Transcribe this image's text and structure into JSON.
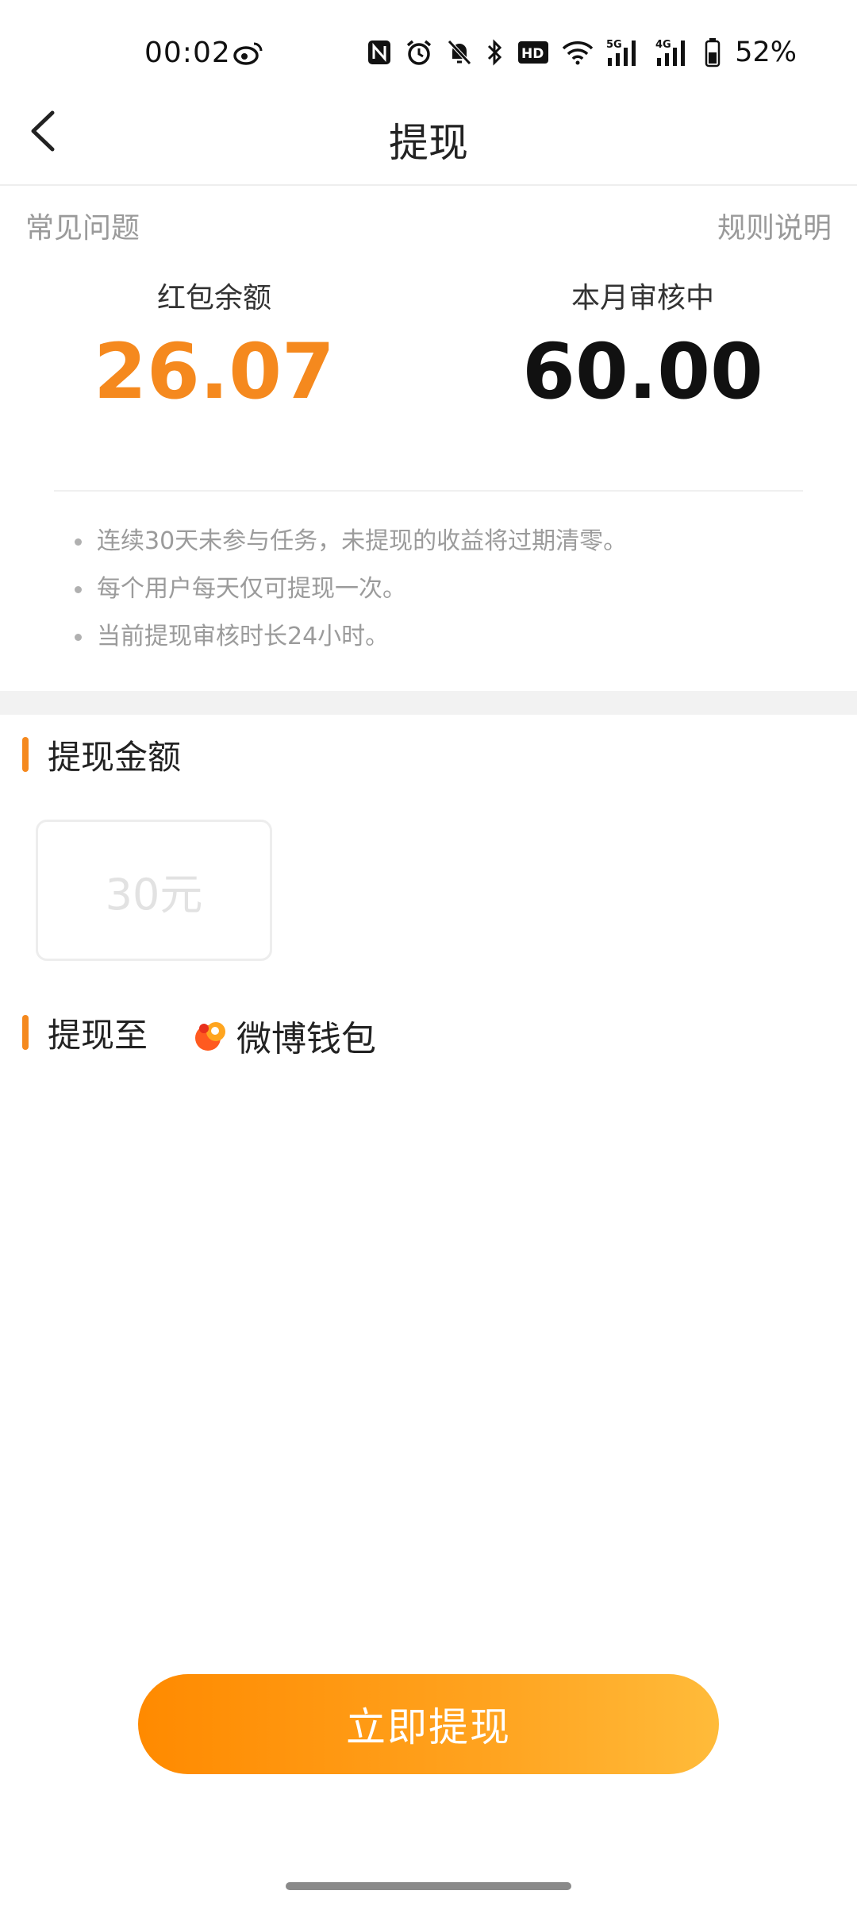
{
  "status_bar": {
    "time": "00:02",
    "battery": "52%",
    "network_5g": "5G",
    "network_4g": "4G",
    "hd_label": "HD",
    "icons": [
      "weibo-icon",
      "nfc-icon",
      "alarm-icon",
      "mute-bell-icon",
      "bluetooth-icon",
      "hd-voice-icon",
      "wifi-icon",
      "signal-5g-icon",
      "signal-4g-icon",
      "battery-icon"
    ]
  },
  "header": {
    "title": "提现",
    "back_icon": "chevron-left-icon"
  },
  "links": {
    "faq": "常见问题",
    "rules": "规则说明"
  },
  "stats": {
    "balance_label": "红包余额",
    "balance_value": "26.07",
    "reviewing_label": "本月审核中",
    "reviewing_value": "60.00"
  },
  "notes": [
    "连续30天未参与任务，未提现的收益将过期清零。",
    "每个用户每天仅可提现一次。",
    "当前提现审核时长24小时。"
  ],
  "withdraw_amount": {
    "title": "提现金额",
    "options": [
      "30元"
    ]
  },
  "withdraw_to": {
    "title": "提现至",
    "wallet_label": "微博钱包",
    "wallet_icon": "weibo-wallet-icon"
  },
  "action": {
    "button_label": "立即提现"
  },
  "colors": {
    "accent": "#f5891e",
    "button_start": "#ff8a00",
    "button_end": "#ffbb3a",
    "muted_text": "#9a9a9a"
  }
}
